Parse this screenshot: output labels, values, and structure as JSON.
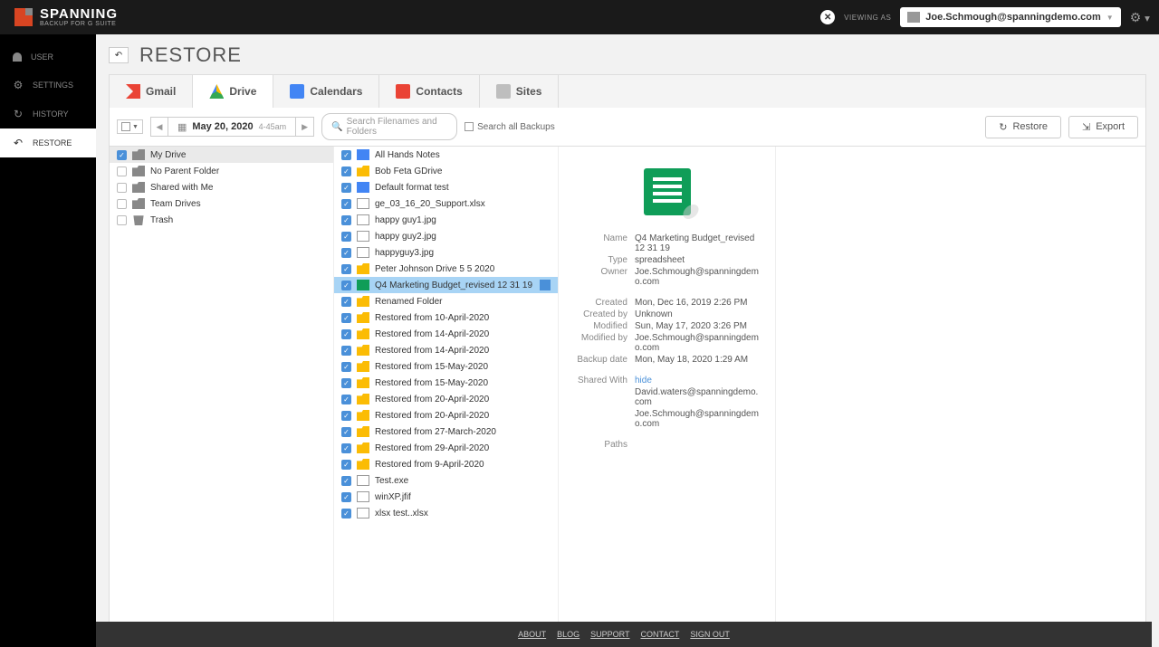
{
  "brand": {
    "name": "SPANNING",
    "subtitle": "BACKUP FOR G SUITE"
  },
  "header": {
    "viewingAs": "VIEWING AS",
    "userEmail": "Joe.Schmough@spanningdemo.com"
  },
  "sidebar": {
    "items": [
      {
        "label": "USER"
      },
      {
        "label": "SETTINGS"
      },
      {
        "label": "HISTORY"
      },
      {
        "label": "RESTORE"
      }
    ]
  },
  "page": {
    "title": "RESTORE"
  },
  "tabs": [
    {
      "label": "Gmail"
    },
    {
      "label": "Drive"
    },
    {
      "label": "Calendars"
    },
    {
      "label": "Contacts"
    },
    {
      "label": "Sites"
    }
  ],
  "toolbar": {
    "date": "May 20, 2020",
    "time": "4-45am",
    "searchPlaceholder": "Search Filenames and Folders",
    "searchAll": "Search all Backups",
    "restore": "Restore",
    "export": "Export"
  },
  "tree": [
    {
      "label": "My Drive",
      "icon": "folder-grey",
      "checked": true,
      "active": true
    },
    {
      "label": "No Parent Folder",
      "icon": "folder-grey",
      "checked": false
    },
    {
      "label": "Shared with Me",
      "icon": "folder-grey",
      "checked": false
    },
    {
      "label": "Team Drives",
      "icon": "folder-grey",
      "checked": false
    },
    {
      "label": "Trash",
      "icon": "trash",
      "checked": false
    }
  ],
  "files": [
    {
      "label": "All Hands Notes",
      "icon": "doc",
      "checked": true
    },
    {
      "label": "Bob Feta GDrive",
      "icon": "folder",
      "checked": true
    },
    {
      "label": "Default format test",
      "icon": "doc",
      "checked": true
    },
    {
      "label": "ge_03_16_20_Support.xlsx",
      "icon": "file",
      "checked": true
    },
    {
      "label": "happy guy1.jpg",
      "icon": "file",
      "checked": true
    },
    {
      "label": "happy guy2.jpg",
      "icon": "file",
      "checked": true
    },
    {
      "label": "happyguy3.jpg",
      "icon": "file",
      "checked": true
    },
    {
      "label": "Peter Johnson Drive 5 5 2020",
      "icon": "folder",
      "checked": true
    },
    {
      "label": "Q4 Marketing Budget_revised 12 31 19",
      "icon": "sheet",
      "checked": true,
      "selected": true,
      "ext": true
    },
    {
      "label": "Renamed Folder",
      "icon": "folder",
      "checked": true
    },
    {
      "label": "Restored from 10-April-2020",
      "icon": "folder",
      "checked": true
    },
    {
      "label": "Restored from 14-April-2020",
      "icon": "folder",
      "checked": true
    },
    {
      "label": "Restored from 14-April-2020",
      "icon": "folder",
      "checked": true
    },
    {
      "label": "Restored from 15-May-2020",
      "icon": "folder",
      "checked": true
    },
    {
      "label": "Restored from 15-May-2020",
      "icon": "folder",
      "checked": true
    },
    {
      "label": "Restored from 20-April-2020",
      "icon": "folder",
      "checked": true
    },
    {
      "label": "Restored from 20-April-2020",
      "icon": "folder",
      "checked": true
    },
    {
      "label": "Restored from 27-March-2020",
      "icon": "folder",
      "checked": true
    },
    {
      "label": "Restored from 29-April-2020",
      "icon": "folder",
      "checked": true
    },
    {
      "label": "Restored from 9-April-2020",
      "icon": "folder",
      "checked": true
    },
    {
      "label": "Test.exe",
      "icon": "file",
      "checked": true
    },
    {
      "label": "winXP.jfif",
      "icon": "file",
      "checked": true
    },
    {
      "label": "xlsx test..xlsx",
      "icon": "file",
      "checked": true
    }
  ],
  "details": {
    "labels": {
      "name": "Name",
      "type": "Type",
      "owner": "Owner",
      "created": "Created",
      "createdBy": "Created by",
      "modified": "Modified",
      "modifiedBy": "Modified by",
      "backupDate": "Backup date",
      "sharedWith": "Shared With",
      "paths": "Paths",
      "hide": "hide"
    },
    "name": "Q4 Marketing Budget_revised 12 31 19",
    "type": "spreadsheet",
    "owner": "Joe.Schmough@spanningdemo.com",
    "created": "Mon, Dec 16, 2019 2:26 PM",
    "createdBy": "Unknown",
    "modified": "Sun, May 17, 2020 3:26 PM",
    "modifiedBy": "Joe.Schmough@spanningdemo.com",
    "backupDate": "Mon, May 18, 2020 1:29 AM",
    "sharedWith": [
      "David.waters@spanningdemo.com",
      "Joe.Schmough@spanningdemo.com"
    ]
  },
  "footer": {
    "about": "ABOUT",
    "blog": "BLOG",
    "support": "SUPPORT",
    "contact": "CONTACT",
    "signout": "SIGN OUT"
  }
}
